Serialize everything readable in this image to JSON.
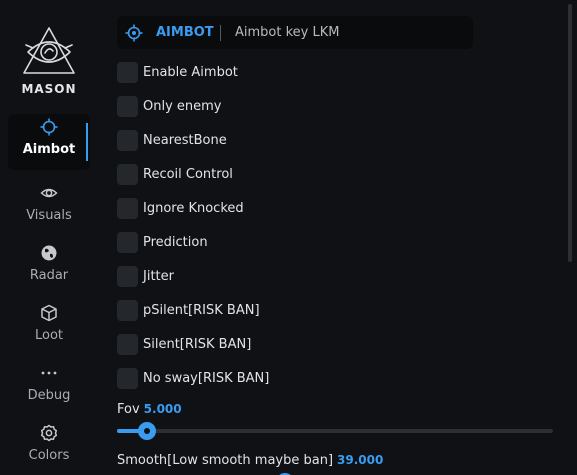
{
  "brand": {
    "name": "MASON",
    "logo_icon": "eye-triangle-logo"
  },
  "colors": {
    "accent": "#3a9cf0",
    "background": "#0f1114",
    "checkbox": "#24272c"
  },
  "sidebar": {
    "items": [
      {
        "label": "Aimbot",
        "icon": "crosshair-icon",
        "active": true
      },
      {
        "label": "Visuals",
        "icon": "eye-icon",
        "active": false
      },
      {
        "label": "Radar",
        "icon": "globe-icon",
        "active": false
      },
      {
        "label": "Loot",
        "icon": "box-icon",
        "active": false
      },
      {
        "label": "Debug",
        "icon": "dots-icon",
        "active": false
      },
      {
        "label": "Colors",
        "icon": "gear-icon",
        "active": false
      }
    ]
  },
  "header": {
    "title": "AIMBOT",
    "key_info": "Aimbot key LKM",
    "icon": "crosshair-icon"
  },
  "options": [
    {
      "label": "Enable Aimbot",
      "checked": false
    },
    {
      "label": "Only enemy",
      "checked": false
    },
    {
      "label": "NearestBone",
      "checked": false
    },
    {
      "label": "Recoil Control",
      "checked": false
    },
    {
      "label": "Ignore Knocked",
      "checked": false
    },
    {
      "label": "Prediction",
      "checked": false
    },
    {
      "label": "Jitter",
      "checked": false
    },
    {
      "label": "pSilent[RISK BAN]",
      "checked": false
    },
    {
      "label": "Silent[RISK BAN]",
      "checked": false
    },
    {
      "label": "No sway[RISK BAN]",
      "checked": false
    }
  ],
  "sliders": [
    {
      "label": "Fov",
      "value": "5.000",
      "fraction": 0.069
    },
    {
      "label": "Smooth[Low smooth maybe ban]",
      "value": "39.000",
      "fraction": 0.385
    }
  ]
}
